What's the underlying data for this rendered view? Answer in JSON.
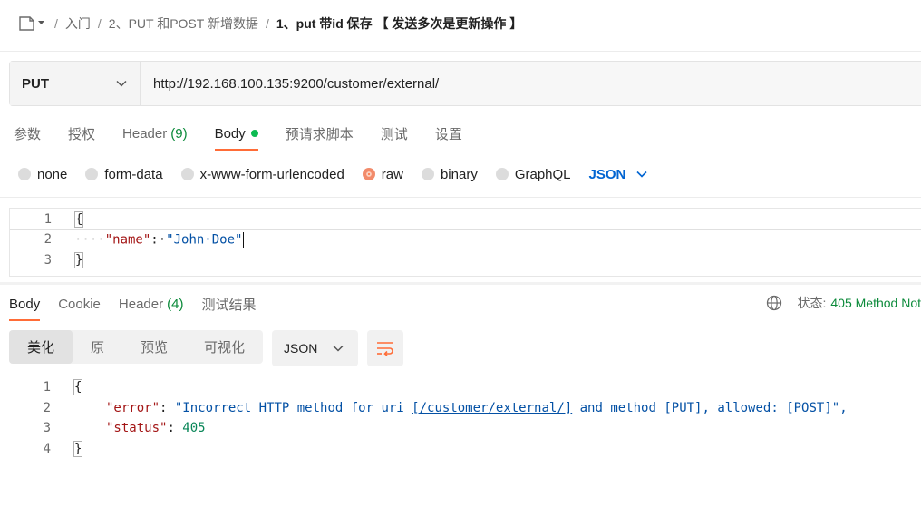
{
  "breadcrumb": {
    "items": [
      "入门",
      "2、PUT 和POST 新增数据"
    ],
    "current": "1、put 带id 保存 【 发送多次是更新操作 】"
  },
  "request": {
    "method": "PUT",
    "url": "http://192.168.100.135:9200/customer/external/",
    "tabs": [
      {
        "label": "参数"
      },
      {
        "label": "授权"
      },
      {
        "label": "Header",
        "count": "(9)"
      },
      {
        "label": "Body"
      },
      {
        "label": "预请求脚本"
      },
      {
        "label": "测试"
      },
      {
        "label": "设置"
      }
    ],
    "active_tab": "Body",
    "body_types": [
      "none",
      "form-data",
      "x-www-form-urlencoded",
      "raw",
      "binary",
      "GraphQL"
    ],
    "selected_body_type": "raw",
    "body_format": "JSON",
    "body_lines": [
      {
        "n": "1",
        "text": "{"
      },
      {
        "n": "2",
        "indent": "····",
        "key": "\"name\"",
        "sep": ":·",
        "value": "\"John·Doe\""
      },
      {
        "n": "3",
        "text": "}"
      }
    ]
  },
  "response": {
    "tabs": [
      {
        "label": "Body"
      },
      {
        "label": "Cookie"
      },
      {
        "label": "Header",
        "count": "(4)"
      },
      {
        "label": "测试结果"
      }
    ],
    "active_tab": "Body",
    "status_label": "状态:",
    "status_value": "405 Method Not",
    "view_modes": [
      "美化",
      "原",
      "预览",
      "可视化"
    ],
    "active_view": "美化",
    "format": "JSON",
    "lines": [
      {
        "n": "1",
        "text": "{"
      },
      {
        "n": "2",
        "key": "\"error\"",
        "value_pre": "\"Incorrect HTTP method for uri ",
        "value_link": "[/customer/external/]",
        "value_post": " and method [PUT], allowed: [POST]\","
      },
      {
        "n": "3",
        "key": "\"status\"",
        "value": "405"
      },
      {
        "n": "4",
        "text": "}"
      }
    ]
  },
  "colors": {
    "accent": "#ff6c37",
    "status_green": "#0b8a3a",
    "format_blue": "#0265d2",
    "body_dot": "#0cbb52"
  }
}
